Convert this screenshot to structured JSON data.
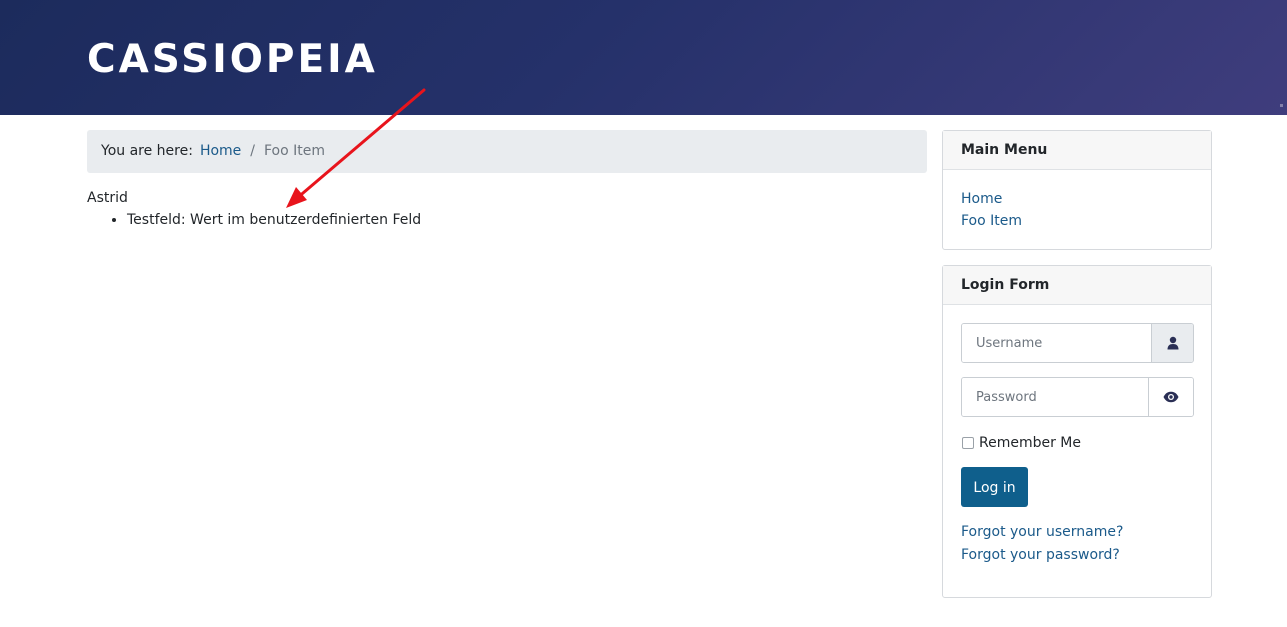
{
  "header": {
    "site_title": "CASSIOPEIA"
  },
  "breadcrumb": {
    "label": "You are here:",
    "items": [
      {
        "text": "Home"
      },
      {
        "text": "Foo Item"
      }
    ],
    "separator": "/"
  },
  "article": {
    "title": "Astrid",
    "fields": [
      {
        "text": "Testfeld: Wert im benutzerdefinierten Feld"
      }
    ]
  },
  "sidebar": {
    "main_menu": {
      "title": "Main Menu",
      "items": [
        {
          "label": "Home"
        },
        {
          "label": "Foo Item"
        }
      ]
    },
    "login_form": {
      "title": "Login Form",
      "username_placeholder": "Username",
      "password_placeholder": "Password",
      "remember_label": "Remember Me",
      "login_button": "Log in",
      "forgot_username": "Forgot your username?",
      "forgot_password": "Forgot your password?"
    }
  },
  "colors": {
    "header_gradient_start": "#1c2b5c",
    "header_gradient_end": "#3f3d7d",
    "link": "#1b5a8a",
    "button": "#0f5f8c",
    "annotation_arrow": "#e8141c"
  },
  "icons": {
    "user_addon": "user-icon",
    "password_toggle": "eye-icon"
  }
}
